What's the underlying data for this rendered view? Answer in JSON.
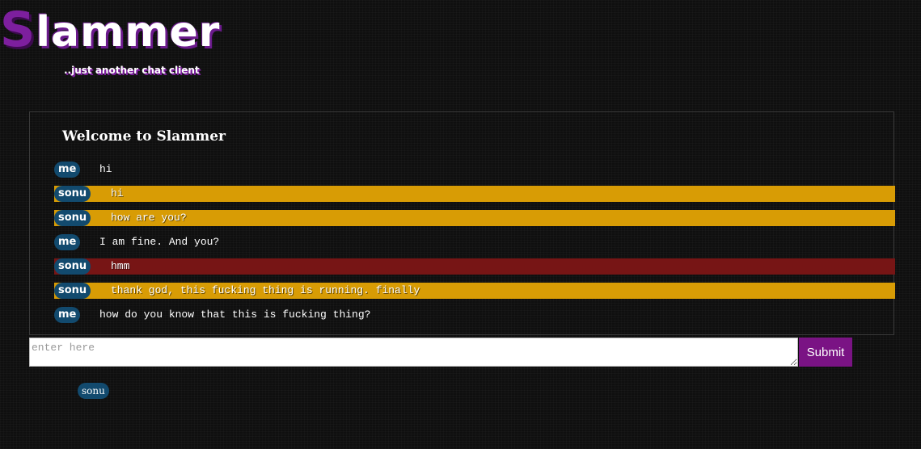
{
  "app": {
    "logo_first_letter": "S",
    "logo_rest": "lammer",
    "tagline": "..just another chat client"
  },
  "chat": {
    "title": "Welcome to Slammer",
    "messages": [
      {
        "sender": "me",
        "text": "hi",
        "style": "mine"
      },
      {
        "sender": "sonu",
        "text": "hi",
        "style": "theirs"
      },
      {
        "sender": "sonu",
        "text": "how are you?",
        "style": "theirs"
      },
      {
        "sender": "me",
        "text": "I am fine. And you?",
        "style": "mine"
      },
      {
        "sender": "sonu",
        "text": "hmm",
        "style": "theirs-alt"
      },
      {
        "sender": "sonu",
        "text": "thank god, this fucking thing is running. finally",
        "style": "theirs"
      },
      {
        "sender": "me",
        "text": "how do you know that this is fucking thing?",
        "style": "mine"
      }
    ]
  },
  "composer": {
    "placeholder": "enter here",
    "value": "",
    "submit_label": "Submit"
  },
  "online_users": [
    "sonu"
  ],
  "colors": {
    "brand_purple": "#7a1384",
    "badge_blue": "#124a6e",
    "bubble_gold": "#d89c05",
    "bubble_red": "#771515"
  }
}
